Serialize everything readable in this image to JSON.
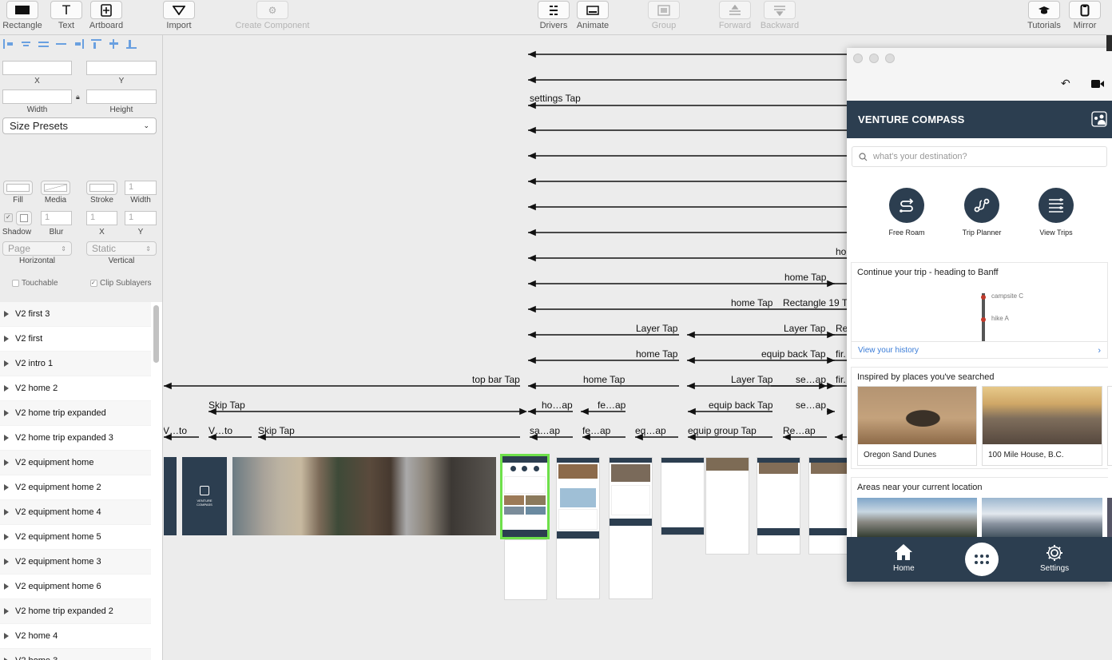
{
  "toolbar": {
    "items": [
      {
        "label": "Rectangle",
        "icon": "rectangle-icon",
        "enabled": true
      },
      {
        "label": "Text",
        "icon": "text-icon",
        "enabled": true
      },
      {
        "label": "Artboard",
        "icon": "artboard-icon",
        "enabled": true
      },
      {
        "label": "Import",
        "icon": "import-icon",
        "enabled": true
      },
      {
        "label": "Create Component",
        "icon": "component-icon",
        "enabled": false
      },
      {
        "label": "Drivers",
        "icon": "drivers-icon",
        "enabled": true
      },
      {
        "label": "Animate",
        "icon": "animate-icon",
        "enabled": true
      },
      {
        "label": "Group",
        "icon": "group-icon",
        "enabled": false
      },
      {
        "label": "Forward",
        "icon": "forward-icon",
        "enabled": false
      },
      {
        "label": "Backward",
        "icon": "backward-icon",
        "enabled": false
      },
      {
        "label": "Tutorials",
        "icon": "graduation-cap-icon",
        "enabled": true
      },
      {
        "label": "Mirror",
        "icon": "mirror-device-icon",
        "enabled": true
      }
    ]
  },
  "inspector": {
    "x_label": "X",
    "y_label": "Y",
    "width_label": "Width",
    "height_label": "Height",
    "size_presets": "Size Presets",
    "fill_label": "Fill",
    "media_label": "Media",
    "stroke_label": "Stroke",
    "stroke_width_label": "Width",
    "stroke_width_value": "1",
    "shadow_label": "Shadow",
    "blur_label": "Blur",
    "blur_value": "1",
    "shadow_x_label": "X",
    "shadow_x_value": "1",
    "shadow_y_label": "Y",
    "shadow_y_value": "1",
    "horizontal_value": "Page",
    "horizontal_label": "Horizontal",
    "vertical_value": "Static",
    "vertical_label": "Vertical",
    "touchable_label": "Touchable",
    "clip_label": "Clip Sublayers"
  },
  "layers": [
    "V2 first 3",
    "V2 first",
    "V2 intro 1",
    "V2 home 2",
    "V2 home trip expanded",
    "V2 home trip expanded 3",
    "V2 equipment home",
    "V2 equipment home 2",
    "V2 equipment home 4",
    "V2 equipment home 5",
    "V2 equipment home 3",
    "V2 equipment home 6",
    "V2 home trip expanded 2",
    "V2 home 4",
    "V2 home 3"
  ],
  "canvas": {
    "labels": {
      "settings": "settings Tap",
      "ho": "ho",
      "home1": "home Tap",
      "home2": "home Tap",
      "rect19": "Rectangle 19 T",
      "layer1": "Layer Tap",
      "layer2": "Layer Tap",
      "re": "Re",
      "home3": "home Tap",
      "equipback1": "equip back Tap",
      "fir1": "fir.",
      "topbar": "top bar Tap",
      "home4": "home Tap",
      "layer3": "Layer Tap",
      "seap1": "se…ap",
      "fir2": "fir.",
      "skip1": "Skip Tap",
      "hoap": "ho…ap",
      "feap1": "fe…ap",
      "equipback2": "equip back Tap",
      "seap2": "se…ap",
      "vto1": "V…to",
      "vto2": "V…to",
      "skip2": "Skip Tap",
      "saap": "sa…ap",
      "feap2": "fe…ap",
      "eqap": "eq…ap",
      "equipgroup": "equip group Tap",
      "reap": "Re…ap"
    },
    "splash_brand": "VENTURE COMPASS"
  },
  "preview": {
    "app_title": "VENTURE COMPASS",
    "search_placeholder": "what's your destination?",
    "quick_actions": [
      "Free Roam",
      "Trip Planner",
      "View Trips"
    ],
    "continue_title": "Continue your trip - heading to Banff",
    "stops": [
      "campsite C",
      "hike A"
    ],
    "history_link": "View your history",
    "inspired_title": "Inspired by places you've searched",
    "inspired_places": [
      "Oregon Sand Dunes",
      "100 Mile House, B.C."
    ],
    "nearby_title": "Areas near your current location",
    "tabs": [
      "Home",
      "Settings"
    ]
  },
  "colors": {
    "brand_navy": "#2c3e50",
    "selection_green": "#6ee04a",
    "link_blue": "#3b7dd8",
    "route_red": "#c0392b"
  }
}
